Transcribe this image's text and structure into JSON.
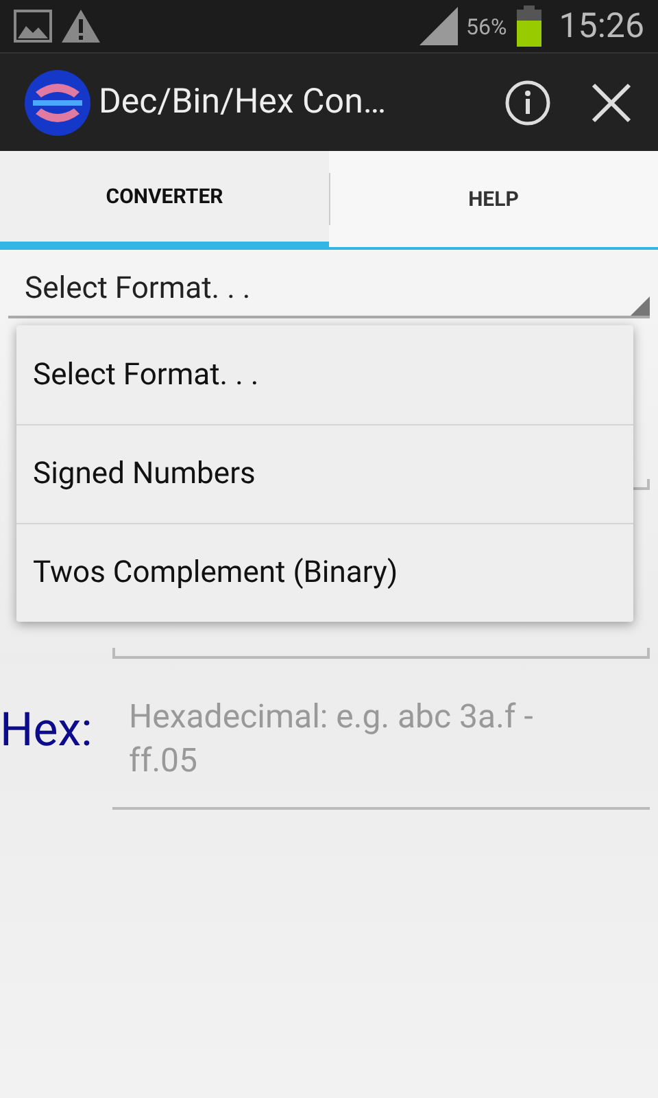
{
  "status_bar": {
    "battery_text": "56%",
    "time": "15:26"
  },
  "action_bar": {
    "title": "Dec/Bin/Hex Con…"
  },
  "tabs": [
    {
      "label": "CONVERTER",
      "selected": true
    },
    {
      "label": "HELP",
      "selected": false
    }
  ],
  "format_spinner": {
    "value": "Select Format. . ."
  },
  "dropdown": {
    "items": [
      {
        "label": "Select Format. . ."
      },
      {
        "label": "Signed Numbers"
      },
      {
        "label": "Twos Complement (Binary)"
      }
    ]
  },
  "hex_row": {
    "label": "Hex:",
    "placeholder": "Hexadecimal: e.g. abc 3a.f - ff.05"
  }
}
